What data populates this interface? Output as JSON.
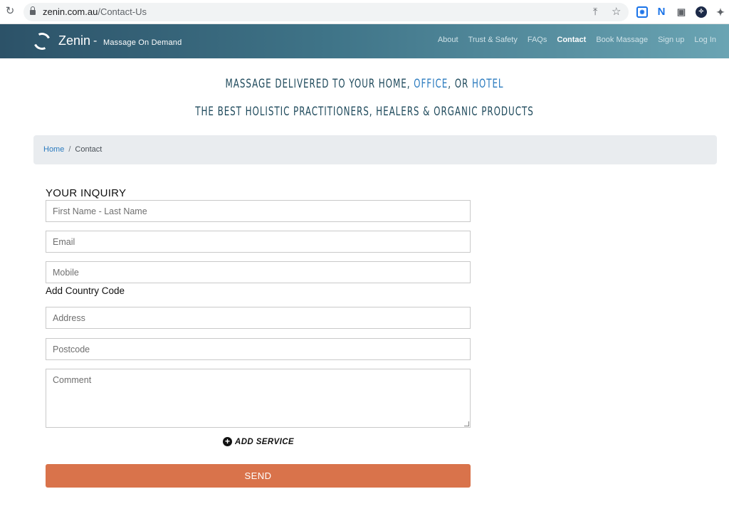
{
  "browser": {
    "url_host": "zenin.com.au",
    "url_path": "/Contact-Us"
  },
  "site": {
    "brand": "Zenin",
    "dash": "-",
    "tagline": "Massage On Demand",
    "nav": [
      {
        "label": "About"
      },
      {
        "label": "Trust & Safety"
      },
      {
        "label": "FAQs"
      },
      {
        "label": "Contact"
      },
      {
        "label": "Book Massage"
      },
      {
        "label": "Sign up"
      },
      {
        "label": "Log In"
      }
    ]
  },
  "hero": {
    "line1_a": "Massage delivered to your home, ",
    "line1_b": "office",
    "line1_c": ", or ",
    "line1_d": "hotel",
    "line2": "The best holistic practitioners, healers & organic products"
  },
  "breadcrumb": {
    "home": "Home",
    "separator": "/",
    "current": "Contact"
  },
  "form": {
    "title": "YOUR INQUIRY",
    "name_placeholder": "First Name - Last Name",
    "email_placeholder": "Email",
    "mobile_placeholder": "Mobile",
    "country_code_label": "Add Country Code",
    "address_placeholder": "Address",
    "postcode_placeholder": "Postcode",
    "comment_placeholder": "Comment",
    "add_service_label": "ADD SERVICE",
    "send_label": "SEND"
  },
  "colors": {
    "send": "#d9734b",
    "link": "#2b7bbf",
    "header_start": "#2c5268",
    "header_end": "#6aa4b3"
  }
}
